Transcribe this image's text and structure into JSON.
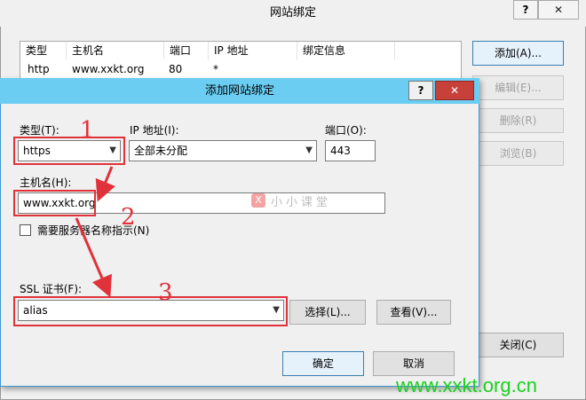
{
  "parent": {
    "title": "网站绑定",
    "help_glyph": "?",
    "close_glyph": "✕",
    "columns": [
      "类型",
      "主机名",
      "端口",
      "IP 地址",
      "绑定信息"
    ],
    "rows": [
      {
        "type": "http",
        "host": "www.xxkt.org",
        "port": "80",
        "ip": "*",
        "binding": ""
      }
    ],
    "buttons": {
      "add": "添加(A)...",
      "edit": "编辑(E)...",
      "delete": "删除(R)",
      "browse": "浏览(B)",
      "close": "关闭(C)"
    }
  },
  "dialog": {
    "title": "添加网站绑定",
    "help_glyph": "?",
    "close_glyph": "✕",
    "type_label": "类型(T):",
    "type_value": "https",
    "ip_label": "IP 地址(I):",
    "ip_value": "全部未分配",
    "port_label": "端口(O):",
    "port_value": "443",
    "host_label": "主机名(H):",
    "host_value": "www.xxkt.org",
    "sni_label": "需要服务器名称指示(N)",
    "sni_checked": false,
    "ssl_label": "SSL 证书(F):",
    "ssl_value": "alias",
    "select_button": "选择(L)...",
    "view_button": "查看(V)...",
    "ok_button": "确定",
    "cancel_button": "取消"
  },
  "annotations": {
    "color": "#e0323a",
    "markers": [
      "1",
      "2",
      "3"
    ]
  },
  "watermarks": {
    "logo_glyph": "X",
    "center_text": "小小课堂",
    "site": "www.xxkt.org.cn"
  }
}
